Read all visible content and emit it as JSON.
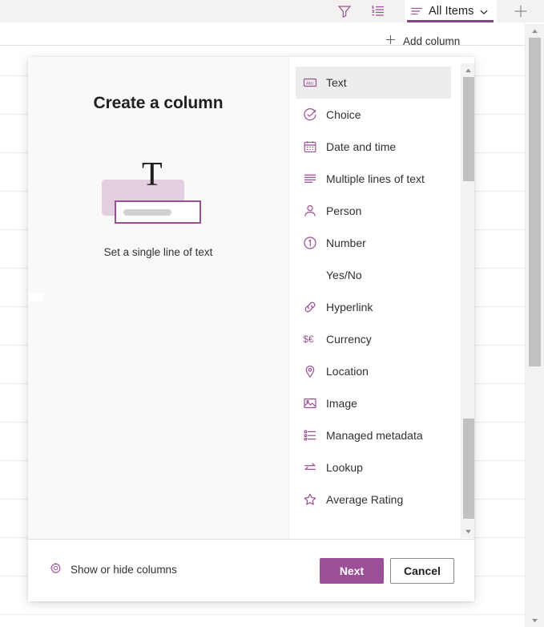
{
  "background": {
    "command_bar": {
      "icons": [
        {
          "name": "filter-icon",
          "label": "Filter"
        },
        {
          "name": "list-format-icon",
          "label": "List formatting"
        }
      ],
      "view_tab": {
        "icon": "view-lines-icon",
        "label": "All Items",
        "chevron": "chevron-down-icon",
        "accent_color": "#87408a"
      },
      "add_view_button": {
        "icon": "plus-icon",
        "label": "Add view"
      }
    },
    "add_column": {
      "icon": "plus-icon",
      "label": "Add column"
    },
    "page_scrollbar": {
      "up_arrow": "scroll-up-arrow",
      "down_arrow": "scroll-down-arrow"
    }
  },
  "dialog": {
    "title": "Create a column",
    "illustration": {
      "glyph": "T",
      "accent_color": "#9b4f96",
      "back_color": "#e4cfe1"
    },
    "caption": "Set a single line of text",
    "column_types": [
      {
        "label": "Text",
        "icon": "abc-box-icon",
        "selected": true
      },
      {
        "label": "Choice",
        "icon": "check-circle-icon",
        "selected": false
      },
      {
        "label": "Date and time",
        "icon": "calendar-icon",
        "selected": false
      },
      {
        "label": "Multiple lines of text",
        "icon": "paragraph-lines-icon",
        "selected": false
      },
      {
        "label": "Person",
        "icon": "person-icon",
        "selected": false
      },
      {
        "label": "Number",
        "icon": "number-circle-icon",
        "selected": false
      },
      {
        "label": "Yes/No",
        "icon": "",
        "selected": false
      },
      {
        "label": "Hyperlink",
        "icon": "link-icon",
        "selected": false
      },
      {
        "label": "Currency",
        "icon": "currency-icon",
        "selected": false
      },
      {
        "label": "Location",
        "icon": "location-pin-icon",
        "selected": false
      },
      {
        "label": "Image",
        "icon": "image-icon",
        "selected": false
      },
      {
        "label": "Managed metadata",
        "icon": "metadata-icon",
        "selected": false
      },
      {
        "label": "Lookup",
        "icon": "lookup-arrows-icon",
        "selected": false
      },
      {
        "label": "Average Rating",
        "icon": "star-icon",
        "selected": false
      }
    ],
    "footer": {
      "show_hide_label": "Show or hide columns",
      "show_hide_icon": "gear-icon",
      "next_label": "Next",
      "cancel_label": "Cancel",
      "primary_color": "#9b4f96"
    },
    "list_scrollbar": {
      "up_arrow": "scroll-up-arrow",
      "down_arrow": "scroll-down-arrow"
    }
  }
}
